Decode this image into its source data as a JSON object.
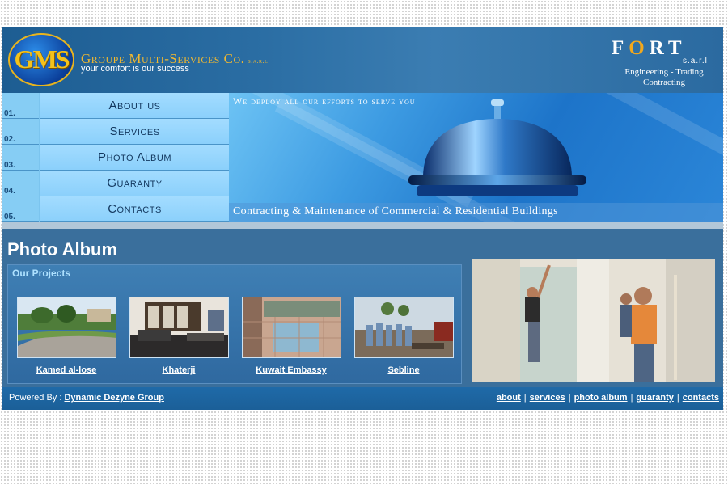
{
  "header": {
    "logo_text": "GMS",
    "company_name": "Groupe Multi-Services Co.",
    "company_suffix": "s.a.r.l",
    "tagline": "your comfort is our success",
    "fort_prefix": "F",
    "fort_o": "O",
    "fort_rest": "RT",
    "fort_sarl": "s.a.r.l",
    "fort_line1": "Engineering - Trading",
    "fort_line2": "Contracting"
  },
  "nav": {
    "items": [
      {
        "num": "01.",
        "label": "About us"
      },
      {
        "num": "02.",
        "label": "Services"
      },
      {
        "num": "03.",
        "label": "Photo Album"
      },
      {
        "num": "04.",
        "label": "Guaranty"
      },
      {
        "num": "05.",
        "label": "Contacts"
      }
    ]
  },
  "banner": {
    "top_text": "We deploy all our efforts to serve you",
    "bottom_text": "Contracting & Maintenance of Commercial & Residential Buildings"
  },
  "main": {
    "title": "Photo Album",
    "section_heading": "Our Projects",
    "projects": [
      {
        "caption": "Kamed al-lose"
      },
      {
        "caption": "Khaterji"
      },
      {
        "caption": "Kuwait Embassy"
      },
      {
        "caption": "Sebline"
      }
    ]
  },
  "footer": {
    "powered_label": "Powered By :",
    "powered_link": "Dynamic Dezyne Group",
    "links": [
      "about",
      "services",
      "photo album",
      "guaranty",
      "contacts"
    ],
    "separator": "|"
  },
  "colors": {
    "page_bg": "#3a6f9c",
    "header_bg": "#2a6da3",
    "nav_bg": "#8bd0fb",
    "footer_bg": "#1f6aa8",
    "logo_gold": "#f4c21b"
  }
}
